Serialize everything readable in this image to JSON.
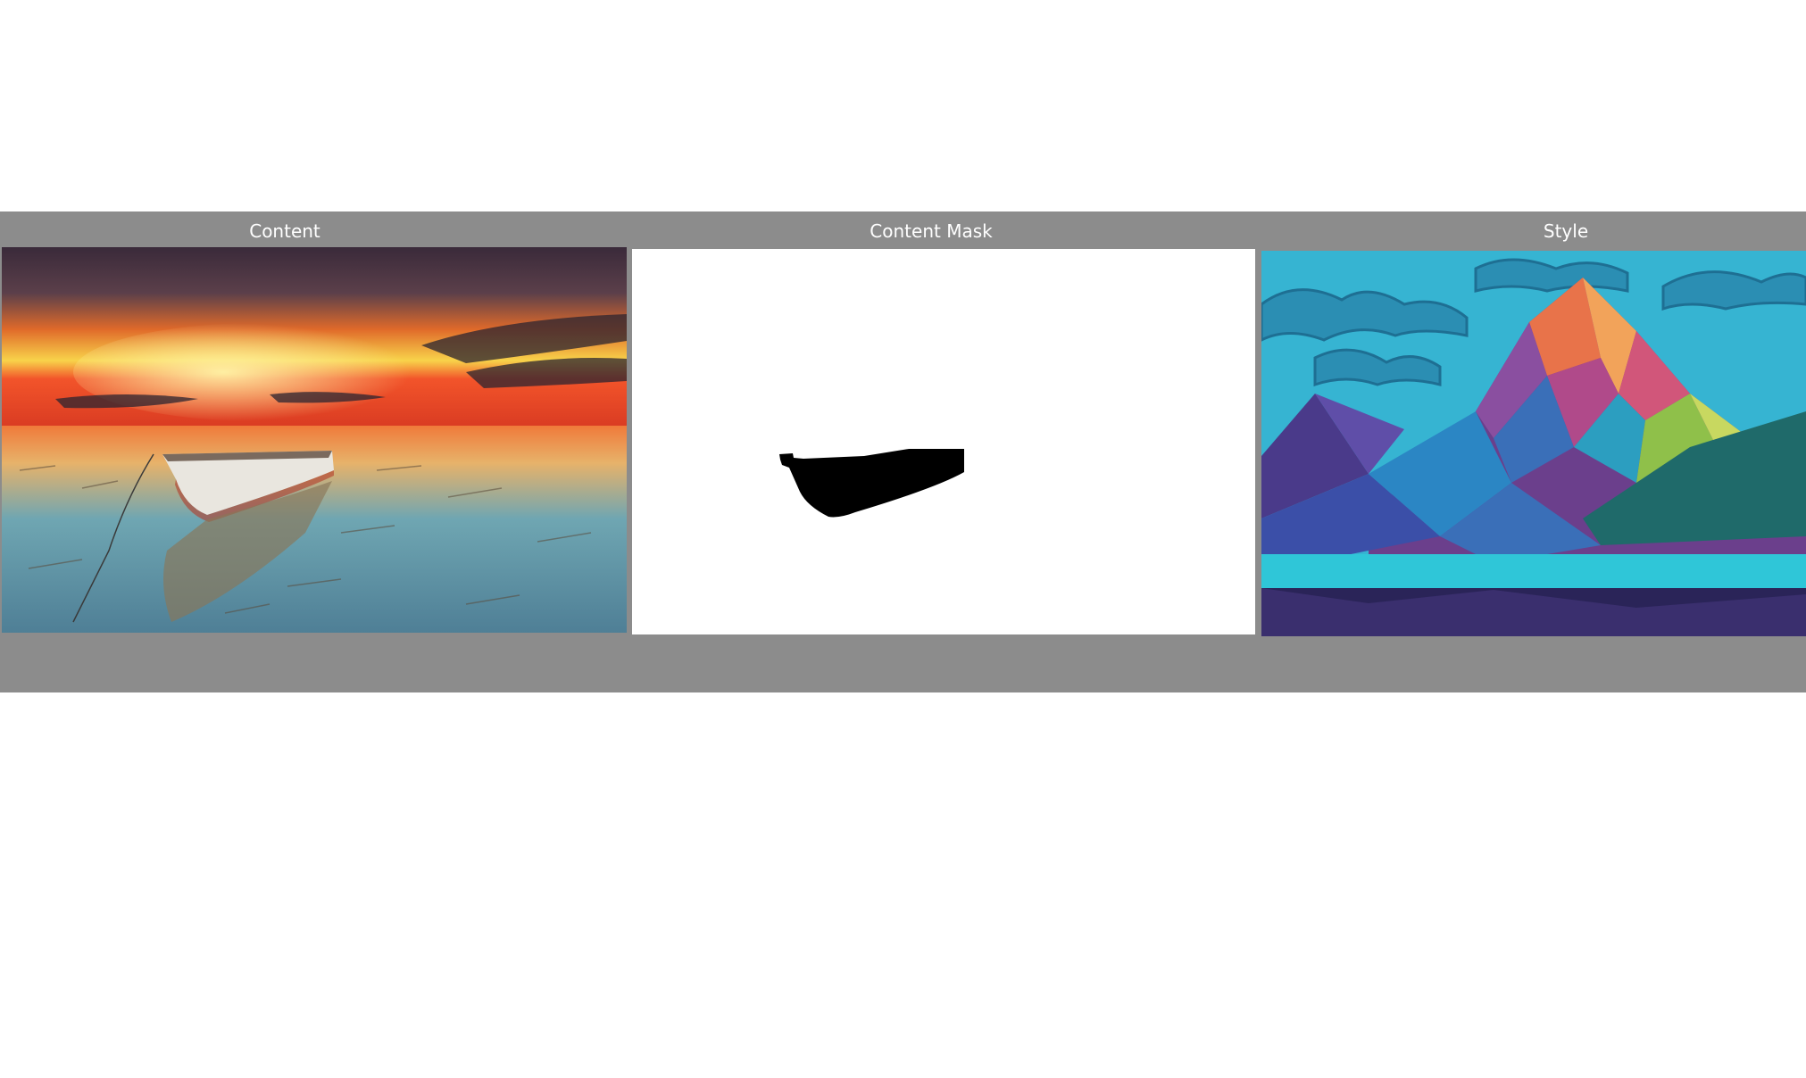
{
  "panels": {
    "content": {
      "label": "Content",
      "image": "sunset-seascape-with-rowboat-photo"
    },
    "mask": {
      "label": "Content Mask",
      "image": "boat-silhouette-mask"
    },
    "style": {
      "label": "Style",
      "image": "low-poly-mountain-painting"
    }
  },
  "colors": {
    "strip": "#8c8c8c",
    "label_text": "#ffffff",
    "mask_bg": "#ffffff",
    "mask_fg": "#000000"
  }
}
